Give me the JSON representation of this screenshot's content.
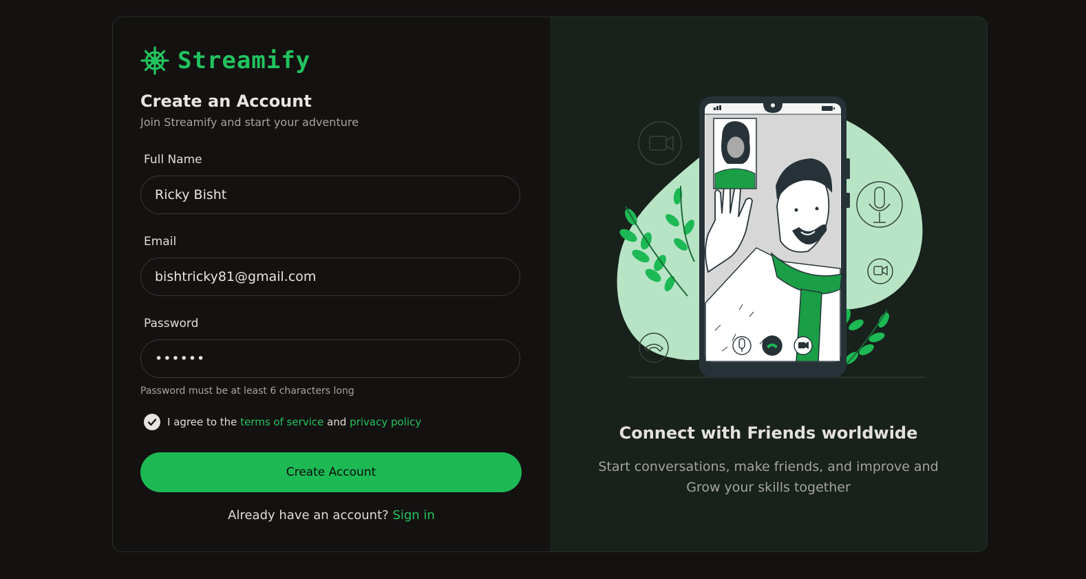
{
  "brand": {
    "name": "Streamify",
    "icon": "ship-wheel-icon",
    "accent": "#22c35e"
  },
  "form": {
    "title": "Create an Account",
    "subtitle": "Join Streamify and start your adventure",
    "full_name": {
      "label": "Full Name",
      "value": "Ricky Bisht"
    },
    "email": {
      "label": "Email",
      "value": "bishtricky81@gmail.com"
    },
    "password": {
      "label": "Password",
      "value": "••••••",
      "hint": "Password must be at least 6 characters long"
    },
    "agree": {
      "prefix": "I agree to the",
      "terms": "terms of service",
      "and": "and",
      "privacy": "privacy policy",
      "checked": true
    },
    "submit_label": "Create Account",
    "signin_prompt": "Already have an account?",
    "signin_link": "Sign in"
  },
  "promo": {
    "title": "Connect with Friends worldwide",
    "text": "Start conversations, make friends, and improve and Grow your skills together"
  },
  "colors": {
    "background": "#141111",
    "panel": "#18211c",
    "button": "#1db954"
  }
}
